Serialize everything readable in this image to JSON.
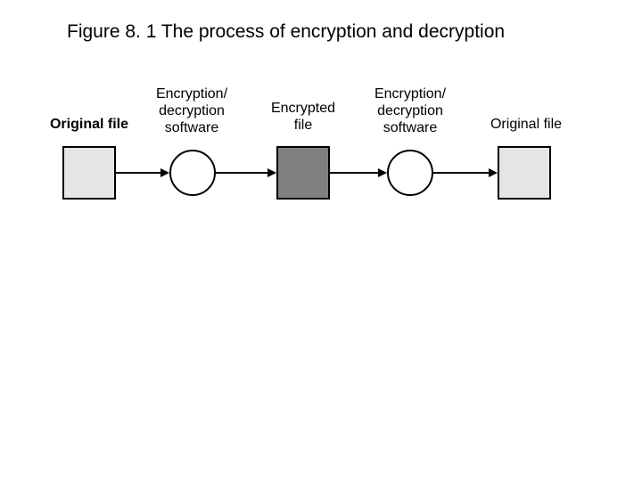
{
  "title": "Figure 8. 1  The process of encryption and decryption",
  "labels": {
    "original_left": "Original file",
    "enc_soft_left": "Encryption/\ndecryption\nsoftware",
    "encrypted": "Encrypted\nfile",
    "enc_soft_right": "Encryption/\ndecryption\nsoftware",
    "original_right": "Original file"
  }
}
